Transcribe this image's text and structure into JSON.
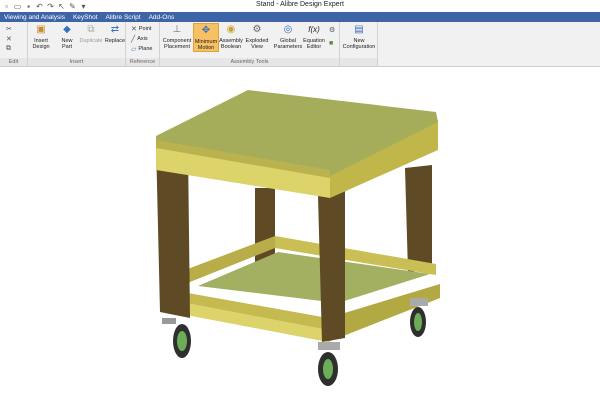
{
  "window": {
    "title": "Stand - Alibre Design Expert"
  },
  "menu": [
    "Viewing and Analysis",
    "KeyShot",
    "Alibre Script",
    "Add-Ons"
  ],
  "ribbon": {
    "groups": {
      "edit": "Edit",
      "insert": "Insert",
      "reference": "Reference",
      "assembly_tools": "Assembly Tools"
    },
    "insert_design": "Insert Design",
    "new_part": "New Part",
    "duplicate": "Duplicate",
    "replace": "Replace",
    "point": "Point",
    "axis": "Axis",
    "plane": "Plane",
    "component_placement": "Component Placement",
    "minimum_motion": "Minimum Motion",
    "assembly_boolean": "Assembly Boolean",
    "exploded_view": "Exploded View",
    "global_parameters": "Global Parameters",
    "equation_editor": "Equation Editor",
    "equation_glyph": "f(x)",
    "new_configuration": "New Configuration"
  },
  "colors": {
    "menubar": "#3e64a8",
    "top_panel": "#a5ad5b",
    "trim": "#dcd36a",
    "legs": "#5e4a25",
    "shelf": "#a3b062"
  },
  "icons": {
    "insert_design": "box-icon",
    "new_part": "new-part-icon",
    "duplicate": "duplicate-icon",
    "replace": "replace-icon",
    "point": "point-icon",
    "axis": "axis-icon",
    "plane": "plane-icon",
    "component_placement": "placement-icon",
    "minimum_motion": "motion-icon",
    "assembly_boolean": "boolean-icon",
    "exploded_view": "exploded-icon",
    "global_parameters": "parameters-icon",
    "equation_editor": "function-icon",
    "new_configuration": "configuration-icon"
  }
}
